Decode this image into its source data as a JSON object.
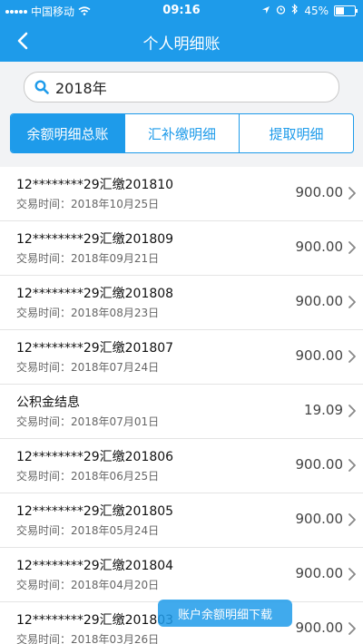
{
  "status_bar": {
    "carrier": "中国移动",
    "time": "09:16",
    "battery": "45%",
    "battery_level": 0.45
  },
  "nav": {
    "title": "个人明细账"
  },
  "search": {
    "value": "2018年"
  },
  "tabs": [
    {
      "label": "余额明细总账",
      "active": true
    },
    {
      "label": "汇补缴明细",
      "active": false
    },
    {
      "label": "提取明细",
      "active": false
    }
  ],
  "date_prefix": "交易时间：",
  "records": [
    {
      "title": "12********29汇缴201810",
      "date": "2018年10月25日",
      "amount": "900.00"
    },
    {
      "title": "12********29汇缴201809",
      "date": "2018年09月21日",
      "amount": "900.00"
    },
    {
      "title": "12********29汇缴201808",
      "date": "2018年08月23日",
      "amount": "900.00"
    },
    {
      "title": "12********29汇缴201807",
      "date": "2018年07月24日",
      "amount": "900.00"
    },
    {
      "title": "公积金结息",
      "date": "2018年07月01日",
      "amount": "19.09"
    },
    {
      "title": "12********29汇缴201806",
      "date": "2018年06月25日",
      "amount": "900.00"
    },
    {
      "title": "12********29汇缴201805",
      "date": "2018年05月24日",
      "amount": "900.00"
    },
    {
      "title": "12********29汇缴201804",
      "date": "2018年04月20日",
      "amount": "900.00"
    },
    {
      "title": "12********29汇缴201803",
      "date": "2018年03月26日",
      "amount": "900.00"
    }
  ],
  "download_button": "账户余额明细下载",
  "colors": {
    "primary": "#1E9BEA",
    "background": "#f2f3f5"
  }
}
